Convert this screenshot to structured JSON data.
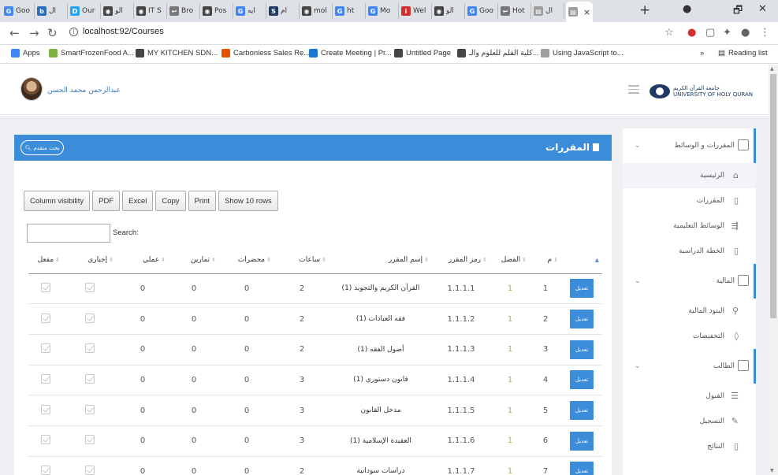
{
  "browser": {
    "tabs": [
      {
        "label": "Goo",
        "fav": "G",
        "color": "#4285f4"
      },
      {
        "label": "ال",
        "fav": "b",
        "color": "#2a6ebb"
      },
      {
        "label": "Our",
        "fav": "D",
        "color": "#2aa4f4"
      },
      {
        "label": "الو",
        "fav": "◉",
        "color": "#444"
      },
      {
        "label": "IT S",
        "fav": "◉",
        "color": "#444"
      },
      {
        "label": "Bro",
        "fav": "↩",
        "color": "#777"
      },
      {
        "label": "Pos",
        "fav": "◉",
        "color": "#444"
      },
      {
        "label": "ايه",
        "fav": "G",
        "color": "#4285f4"
      },
      {
        "label": "ام",
        "fav": "S",
        "color": "#1f3b66"
      },
      {
        "label": "mol",
        "fav": "◉",
        "color": "#444"
      },
      {
        "label": "ht",
        "fav": "G",
        "color": "#4285f4"
      },
      {
        "label": "Mo",
        "fav": "G",
        "color": "#4285f4"
      },
      {
        "label": "Wel",
        "fav": "i",
        "color": "#d32f2f"
      },
      {
        "label": "الو",
        "fav": "◉",
        "color": "#444"
      },
      {
        "label": "Goo",
        "fav": "G",
        "color": "#4285f4"
      },
      {
        "label": "Hot",
        "fav": "↩",
        "color": "#777"
      },
      {
        "label": "ال",
        "fav": "▤",
        "color": "#9e9e9e"
      }
    ],
    "active_tab": {
      "label": "",
      "close": "×"
    },
    "new_tab": "+",
    "url": "localhost:92/Courses",
    "bookmarks": [
      {
        "label": "Apps",
        "color": "#4285f4"
      },
      {
        "label": "SmartFrozenFood A...",
        "color": "#7cb342"
      },
      {
        "label": "MY KITCHEN SDN...",
        "color": "#444"
      },
      {
        "label": "Carbonless Sales Re...",
        "color": "#e65100"
      },
      {
        "label": "Create Meeting | Pr...",
        "color": "#1976d2"
      },
      {
        "label": "Untitled Page",
        "color": "#444"
      },
      {
        "label": "كلية القلم للعلوم والـ...",
        "color": "#444"
      },
      {
        "label": "Using JavaScript to...",
        "color": "#9e9e9e"
      }
    ],
    "reading_list": "Reading list",
    "more": "»"
  },
  "header": {
    "username": "عبدالرحمن محمد الحسن",
    "logo_line1": "جامعة القرآن الكريم",
    "logo_line2": "UNIVERSITY OF HOLY QURAN"
  },
  "card": {
    "title": "المقررات",
    "help_button": "بحث متقدم"
  },
  "buttons": [
    "Column visibility",
    "PDF",
    "Excel",
    "Copy",
    "Print",
    "Show 10 rows"
  ],
  "search": {
    "label": "Search:",
    "value": ""
  },
  "table": {
    "headers": [
      "م",
      "الفصل",
      "رمز المقرر",
      "إسم المقرر",
      "ساعات",
      "محضرات",
      "تمارين",
      "عملي",
      "إجباري",
      "مفعل"
    ],
    "edit_label": "تعديل",
    "rows": [
      {
        "id": "1",
        "semester": "1",
        "code": "1.1.1.1",
        "name": "القرآن الكريم والتجويد (1)",
        "hours": "2",
        "lectures": "0",
        "exercises": "0",
        "practical": "0"
      },
      {
        "id": "2",
        "semester": "1",
        "code": "1.1.1.2",
        "name": "فقه العبادات (1)",
        "hours": "2",
        "lectures": "0",
        "exercises": "0",
        "practical": "0"
      },
      {
        "id": "3",
        "semester": "1",
        "code": "1.1.1.3",
        "name": "أصول الفقه (1)",
        "hours": "2",
        "lectures": "0",
        "exercises": "0",
        "practical": "0"
      },
      {
        "id": "4",
        "semester": "1",
        "code": "1.1.1.4",
        "name": "قانون دستوري (1)",
        "hours": "3",
        "lectures": "0",
        "exercises": "0",
        "practical": "0"
      },
      {
        "id": "5",
        "semester": "1",
        "code": "1.1.1.5",
        "name": "مدخل القانون",
        "hours": "3",
        "lectures": "0",
        "exercises": "0",
        "practical": "0"
      },
      {
        "id": "6",
        "semester": "1",
        "code": "1.1.1.6",
        "name": "العقيدة الإسلامية (1)",
        "hours": "3",
        "lectures": "0",
        "exercises": "0",
        "practical": "0"
      },
      {
        "id": "7",
        "semester": "1",
        "code": "1.1.1.7",
        "name": "دراسات سودانية",
        "hours": "2",
        "lectures": "0",
        "exercises": "0",
        "practical": "0"
      }
    ]
  },
  "sidebar": {
    "sections": [
      {
        "label": "المقررات و الوسائط",
        "items": [
          "الرئيسية",
          "المقررات",
          "الوسائط التعليمية",
          "الخطة الدراسية"
        ]
      },
      {
        "label": "المالية",
        "items": [
          "البنود المالية",
          "التخفيضات"
        ]
      },
      {
        "label": "الطالب",
        "items": [
          "القبول",
          "التسجيل",
          "النتائج"
        ]
      }
    ]
  }
}
